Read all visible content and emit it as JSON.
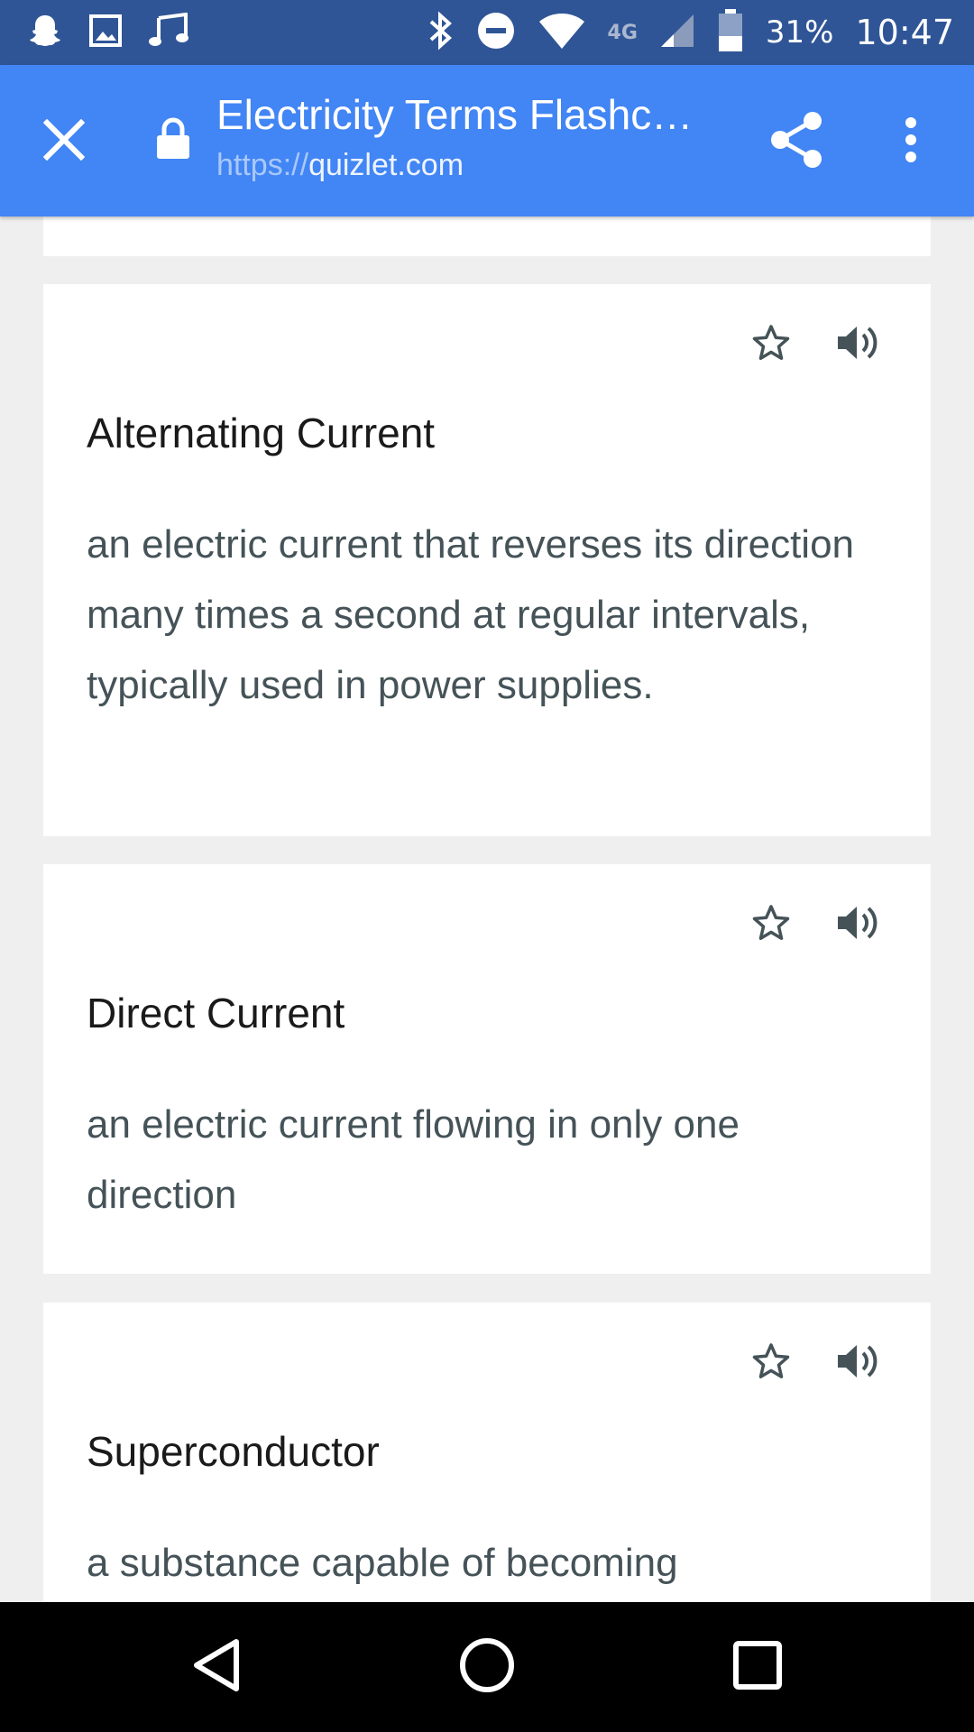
{
  "status_bar": {
    "battery_percent": "31%",
    "time": "10:47",
    "network_type": "4G",
    "icons_left": [
      "snapchat-icon",
      "gallery-icon",
      "music-icon"
    ],
    "icons_right": [
      "bluetooth-icon",
      "do-not-disturb-icon",
      "wifi-icon",
      "cell-signal-icon",
      "battery-icon"
    ]
  },
  "app_bar": {
    "title": "Electricity Terms Flashc…",
    "url_scheme": "https://",
    "url_host": "quizlet.com",
    "close_icon": "close-icon",
    "lock_icon": "lock-icon",
    "share_icon": "share-icon",
    "more_icon": "more-vertical-icon"
  },
  "cards": [
    {
      "term": "Alternating Current",
      "definition": "an electric current that reverses its direction many times a second at regular intervals, typically used in power supplies."
    },
    {
      "term": "Direct Current",
      "definition": "an electric current flowing in only one direction"
    },
    {
      "term": "Superconductor",
      "definition": "a substance capable of becoming"
    }
  ],
  "nav_bar": {
    "back_icon": "back-triangle-icon",
    "home_icon": "home-circle-icon",
    "recents_icon": "recents-square-icon"
  },
  "colors": {
    "status_bar": "#2f5596",
    "app_bar": "#4285f4",
    "page_background": "#efefef",
    "card_background": "#ffffff",
    "term_text": "#1a1a1a",
    "definition_text": "#455358",
    "icon": "#455358"
  }
}
